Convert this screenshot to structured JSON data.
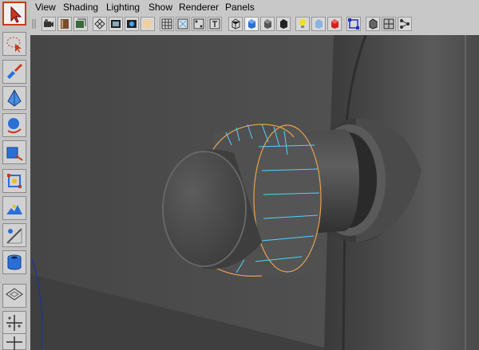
{
  "menu": {
    "view": "View",
    "shading": "Shading",
    "lighting": "Lighting",
    "show": "Show",
    "renderer": "Renderer",
    "panels": "Panels"
  },
  "toolbox": [
    "select-tool-icon",
    "lasso-tool-icon",
    "paint-select-icon",
    "move-tool-icon",
    "rotate-tool-icon",
    "scale-tool-icon",
    "universal-manipulator-icon",
    "soft-modify-icon",
    "show-manipulator-icon",
    "cylinder-object-icon",
    "layout-single-icon",
    "layout-four-icon",
    "layout-side-by-side-icon"
  ],
  "colors": {
    "viewport_bg": "#4a4a4a",
    "selection_edge": "#e8a050",
    "wire": "#4fd2ff",
    "accent_red": "#c83a1a"
  }
}
